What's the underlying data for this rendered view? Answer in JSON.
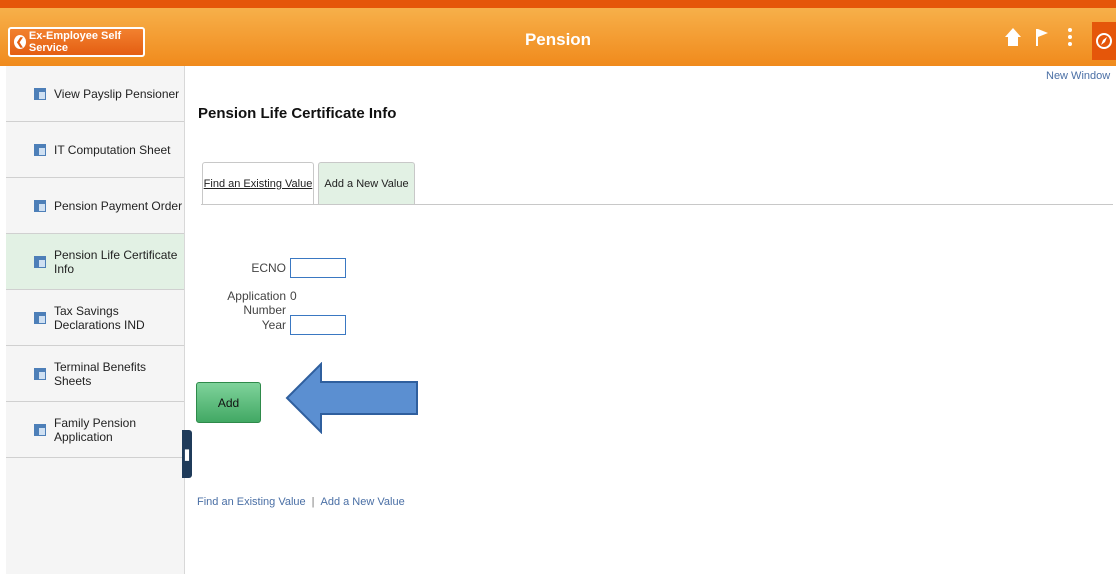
{
  "header": {
    "back_label": "Ex-Employee Self Service",
    "title": "Pension",
    "icons": [
      "home-icon",
      "flag-icon",
      "more-options-icon",
      "navbar-compass-icon"
    ]
  },
  "sidebar": {
    "items": [
      {
        "label": "View Payslip Pensioner",
        "active": false
      },
      {
        "label": "IT Computation Sheet",
        "active": false
      },
      {
        "label": "Pension Payment Order",
        "active": false
      },
      {
        "label": "Pension Life Certificate Info",
        "active": true
      },
      {
        "label": "Tax Savings Declarations IND",
        "active": false
      },
      {
        "label": "Terminal Benefits Sheets",
        "active": false
      },
      {
        "label": "Family Pension Application",
        "active": false
      }
    ]
  },
  "content": {
    "new_window": "New Window",
    "title": "Pension Life Certificate Info",
    "tabs": [
      {
        "label": "Find an Existing Value",
        "active": false
      },
      {
        "label": "Add a New Value",
        "active": true
      }
    ],
    "form": {
      "ecno_label": "ECNO",
      "ecno_value": "",
      "application_number_label": "Application Number",
      "application_number_value": "0",
      "year_label": "Year",
      "year_value": ""
    },
    "add_button": "Add",
    "bottom_links": {
      "find": "Find an Existing Value",
      "separator": "|",
      "add": "Add a New Value"
    }
  },
  "colors": {
    "header_orange": "#f08a1c",
    "accent_green": "#42a864",
    "annotation_arrow": "#5b8fd1"
  }
}
